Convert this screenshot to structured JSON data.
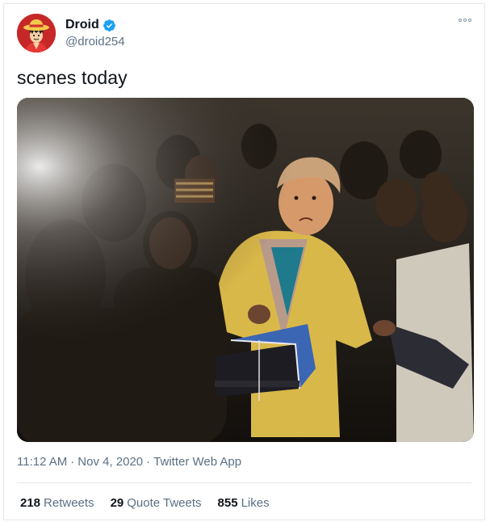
{
  "user": {
    "display_name": "Droid",
    "handle": "@droid254",
    "verified": true,
    "avatar_icon": "straw-hat-character-avatar"
  },
  "tweet": {
    "text": "scenes today",
    "media_description_icon": "photo-crowd-man-carrying-boxes"
  },
  "meta": {
    "time": "11:12 AM",
    "separator1": "·",
    "date": "Nov 4, 2020",
    "separator2": "·",
    "source": "Twitter Web App"
  },
  "stats": {
    "retweets_count": "218",
    "retweets_label": "Retweets",
    "quotes_count": "29",
    "quotes_label": "Quote Tweets",
    "likes_count": "855",
    "likes_label": "Likes"
  },
  "colors": {
    "text_primary": "#0f1419",
    "text_secondary": "#5b7083",
    "verified_blue": "#1da1f2",
    "border": "#e1e8ed"
  }
}
